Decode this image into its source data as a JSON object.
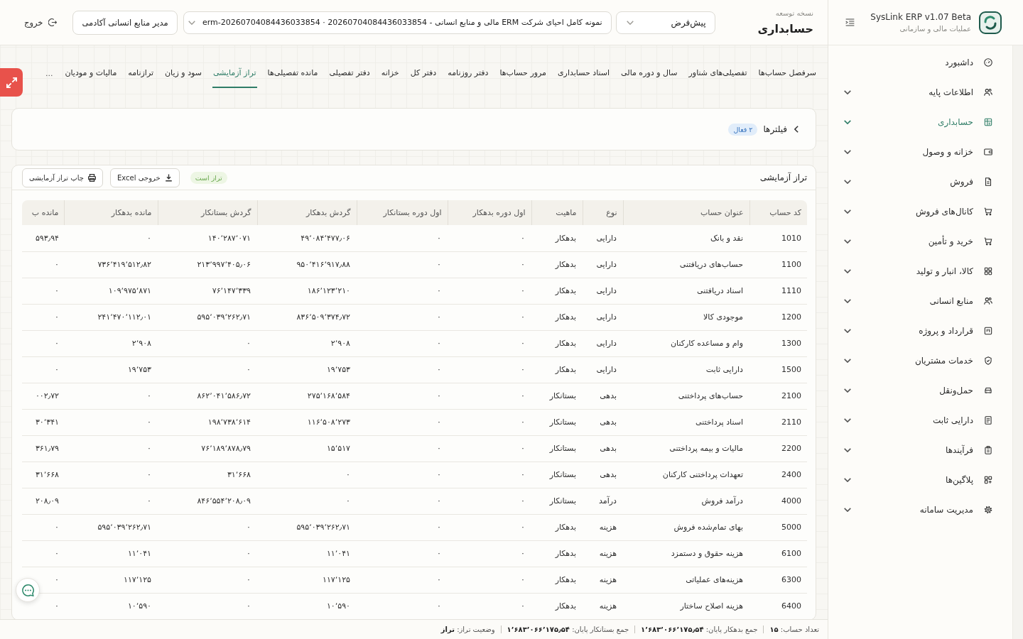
{
  "sidebar": {
    "app_name": "SysLink ERP v1.07 Beta",
    "app_subtitle": "عملیات مالی و سازمانی",
    "items": [
      {
        "label": "داشبورد",
        "selected": false,
        "expandable": false
      },
      {
        "label": "اطلاعات پایه",
        "selected": false,
        "expandable": true
      },
      {
        "label": "حسابداری",
        "selected": true,
        "expandable": true
      },
      {
        "label": "خزانه و وصول",
        "selected": false,
        "expandable": true
      },
      {
        "label": "فروش",
        "selected": false,
        "expandable": true
      },
      {
        "label": "کانال‌های فروش",
        "selected": false,
        "expandable": true
      },
      {
        "label": "خرید و تأمین",
        "selected": false,
        "expandable": true
      },
      {
        "label": "کالا، انبار و تولید",
        "selected": false,
        "expandable": true
      },
      {
        "label": "منابع انسانی",
        "selected": false,
        "expandable": true
      },
      {
        "label": "قرارداد و پروژه",
        "selected": false,
        "expandable": true
      },
      {
        "label": "خدمات مشتریان",
        "selected": false,
        "expandable": true
      },
      {
        "label": "حمل‌ونقل",
        "selected": false,
        "expandable": true
      },
      {
        "label": "دارایی ثابت",
        "selected": false,
        "expandable": true
      },
      {
        "label": "فرآیندها",
        "selected": false,
        "expandable": true
      },
      {
        "label": "پلاگین‌ها",
        "selected": false,
        "expandable": true
      },
      {
        "label": "مدیریت سامانه",
        "selected": false,
        "expandable": true
      }
    ]
  },
  "header": {
    "eyebrow": "نسخه توسعه",
    "title": "حسابداری",
    "profile_select": {
      "value": "پیش‌فرض"
    },
    "company_select": {
      "value": "نمونه کامل احیای شرکت ERM مالی و منابع انسانی - 20260704084436033854 · erm-20260704084436033854"
    },
    "role_button": "مدیر منابع انسانی آکادمی",
    "logout_button": "خروج"
  },
  "tabs": [
    {
      "label": "سرفصل حساب‌ها",
      "selected": false
    },
    {
      "label": "تفصیلی‌های شناور",
      "selected": false
    },
    {
      "label": "سال و دوره مالی",
      "selected": false
    },
    {
      "label": "اسناد حسابداری",
      "selected": false
    },
    {
      "label": "مرور حساب‌ها",
      "selected": false
    },
    {
      "label": "دفتر روزنامه",
      "selected": false
    },
    {
      "label": "دفتر کل",
      "selected": false
    },
    {
      "label": "خزانه",
      "selected": false
    },
    {
      "label": "دفتر تفصیلی",
      "selected": false
    },
    {
      "label": "مانده تفصیلی‌ها",
      "selected": false
    },
    {
      "label": "تراز آزمایشی",
      "selected": true
    },
    {
      "label": "سود و زیان",
      "selected": false
    },
    {
      "label": "ترازنامه",
      "selected": false
    },
    {
      "label": "مالیات و مودیان",
      "selected": false
    }
  ],
  "tabs_more": "...",
  "filters": {
    "title": "فیلترها",
    "badge": "۲ فعال",
    "expanded": false
  },
  "report": {
    "title": "تراز آزمایشی",
    "status_badge": "تراز است",
    "buttons": [
      {
        "kind": "export",
        "label": "خروجی Excel"
      },
      {
        "kind": "print",
        "label": "چاپ تراز آزمایشی"
      }
    ]
  },
  "table": {
    "columns": [
      "کد حساب",
      "عنوان حساب",
      "نوع",
      "ماهیت",
      "اول دوره بدهکار",
      "اول دوره بستانکار",
      "گردش بدهکار",
      "گردش بستانکار",
      "مانده بدهکار",
      "مانده ب"
    ],
    "rows": [
      [
        "1010",
        "نقد و بانک",
        "دارایی",
        "بدهکار",
        "۰",
        "۰",
        "۴۹٬۰۸۴٬۴۷۷٫۰۶",
        "۱۴۰٬۲۸۷٬۰۷۱",
        "۰",
        "۵۹۳٫۹۴"
      ],
      [
        "1100",
        "حساب‌های دریافتنی",
        "دارایی",
        "بدهکار",
        "۰",
        "۰",
        "۹۵۰٬۴۱۶٬۹۱۷٫۸۸",
        "۲۱۳٬۹۹۷٬۴۰۵٫۰۶",
        "۷۳۶٬۴۱۹٬۵۱۲٫۸۲",
        "۰"
      ],
      [
        "1110",
        "اسناد دریافتنی",
        "دارایی",
        "بدهکار",
        "۰",
        "۰",
        "۱۸۶٬۱۲۳٬۲۱۰",
        "۷۶٬۱۴۷٬۳۳۹",
        "۱۰۹٬۹۷۵٬۸۷۱",
        "۰"
      ],
      [
        "1200",
        "موجودی کالا",
        "دارایی",
        "بدهکار",
        "۰",
        "۰",
        "۸۳۶٬۵۰۹٬۳۷۴٫۷۲",
        "۵۹۵٬۰۳۹٬۲۶۲٫۷۱",
        "۲۴۱٬۴۷۰٬۱۱۲٫۰۱",
        "۰"
      ],
      [
        "1300",
        "وام و مساعده کارکنان",
        "دارایی",
        "بدهکار",
        "۰",
        "۰",
        "۲٬۹۰۸",
        "۰",
        "۲٬۹۰۸",
        "۰"
      ],
      [
        "1500",
        "دارایی ثابت",
        "دارایی",
        "بدهکار",
        "۰",
        "۰",
        "۱۹٬۷۵۳",
        "۰",
        "۱۹٬۷۵۳",
        "۰"
      ],
      [
        "2100",
        "حساب‌های پرداختنی",
        "بدهی",
        "بستانکار",
        "۰",
        "۰",
        "۲۷۵٬۱۶۸٬۵۸۴",
        "۸۶۲٬۰۴۱٬۵۸۶٫۷۲",
        "۰",
        "۰۰۲٫۷۲"
      ],
      [
        "2110",
        "اسناد پرداختنی",
        "بدهی",
        "بستانکار",
        "۰",
        "۰",
        "۱۱۶٬۵۰۸٬۲۷۳",
        "۱۹۸٬۷۳۸٬۶۱۴",
        "۰",
        "۳۰٬۳۴۱"
      ],
      [
        "2200",
        "مالیات و بیمه پرداختنی",
        "بدهی",
        "بستانکار",
        "۰",
        "۰",
        "۱۵٬۵۱۷",
        "۷۶٬۱۸۹٬۸۷۸٫۷۹",
        "۰",
        "۳۶۱٫۷۹"
      ],
      [
        "2400",
        "تعهدات پرداختنی کارکنان",
        "بدهی",
        "بستانکار",
        "۰",
        "۰",
        "۰",
        "۳۱٬۶۶۸",
        "۰",
        "۳۱٬۶۶۸"
      ],
      [
        "4000",
        "درآمد فروش",
        "درآمد",
        "بستانکار",
        "۰",
        "۰",
        "۰",
        "۸۴۶٬۵۵۴٬۲۰۸٫۰۹",
        "۰",
        "۲۰۸٫۰۹"
      ],
      [
        "5000",
        "بهای تمام‌شده فروش",
        "هزینه",
        "بدهکار",
        "۰",
        "۰",
        "۵۹۵٬۰۳۹٬۲۶۲٫۷۱",
        "۰",
        "۵۹۵٬۰۳۹٬۲۶۲٫۷۱",
        "۰"
      ],
      [
        "6100",
        "هزینه حقوق و دستمزد",
        "هزینه",
        "بدهکار",
        "۰",
        "۰",
        "۱۱٬۰۴۱",
        "۰",
        "۱۱٬۰۴۱",
        "۰"
      ],
      [
        "6300",
        "هزینه‌های عملیاتی",
        "هزینه",
        "بدهکار",
        "۰",
        "۰",
        "۱۱۷٬۱۲۵",
        "۰",
        "۱۱۷٬۱۲۵",
        "۰"
      ],
      [
        "6400",
        "هزینه اصلاح ساختار",
        "هزینه",
        "بدهکار",
        "۰",
        "۰",
        "۱۰٬۵۹۰",
        "۰",
        "۱۰٬۵۹۰",
        "۰"
      ]
    ]
  },
  "status_bar": {
    "items": [
      {
        "label": "تعداد حساب:",
        "value": "۱۵"
      },
      {
        "label": "جمع بدهکار پایان:",
        "value": "۱٬۶۸۳٬۰۶۶٬۱۷۵٫۵۴"
      },
      {
        "label": "جمع بستانکار پایان:",
        "value": "۱٬۶۸۳٬۰۶۶٬۱۷۵٫۵۴"
      },
      {
        "label": "وضعیت تراز:",
        "value": "تراز"
      }
    ]
  }
}
